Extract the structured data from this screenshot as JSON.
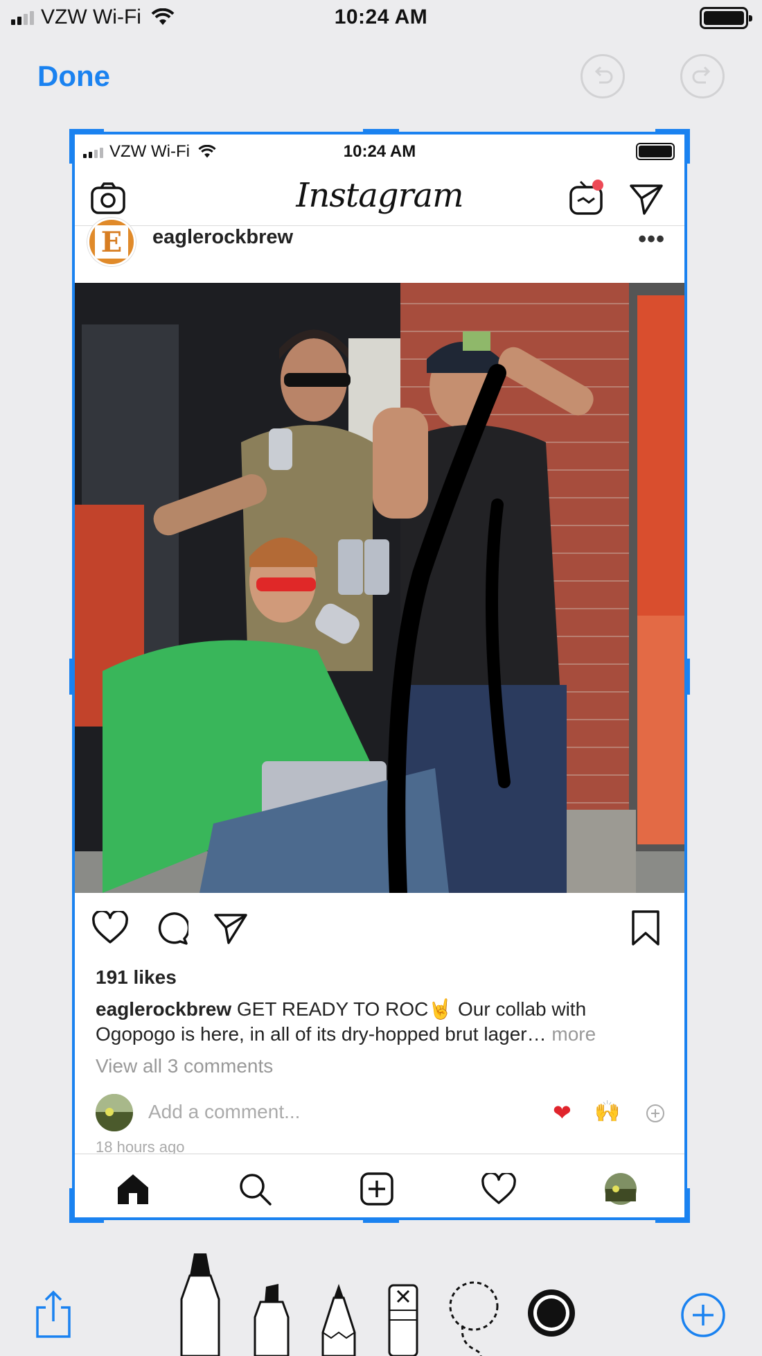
{
  "outer_status": {
    "carrier": "VZW Wi-Fi",
    "time": "10:24 AM"
  },
  "toolbar": {
    "done_label": "Done"
  },
  "inner_status": {
    "carrier": "VZW Wi-Fi",
    "time": "10:24 AM"
  },
  "instagram": {
    "logo": "Instagram",
    "post": {
      "avatar_letter": "E",
      "username": "eaglerockbrew",
      "more": "•••",
      "likes": "191 likes",
      "caption_user": "eaglerockbrew",
      "caption_text": " GET READY TO ROC🤘 Our collab with Ogopogo is here, in all of its dry-hopped brut lager…",
      "caption_more": " more",
      "view_comments": "View all 3 comments",
      "comment_placeholder": "Add a comment...",
      "emoji_heart": "❤",
      "emoji_raised_hands": "🙌",
      "timestamp": "18 hours ago"
    }
  },
  "icons": [
    "camera-icon",
    "igtv-icon",
    "direct-icon",
    "like-icon",
    "comment-icon",
    "share-icon",
    "bookmark-icon",
    "home-icon",
    "search-icon",
    "new-post-icon",
    "activity-icon",
    "profile-icon",
    "undo-icon",
    "redo-icon",
    "share-sheet-icon",
    "pen-tool-icon",
    "marker-tool-icon",
    "pencil-tool-icon",
    "eraser-tool-icon",
    "lasso-tool-icon",
    "color-picker-icon",
    "add-icon"
  ],
  "colors": {
    "accent": "#1a82f0",
    "notification_dot": "#ed4956"
  }
}
